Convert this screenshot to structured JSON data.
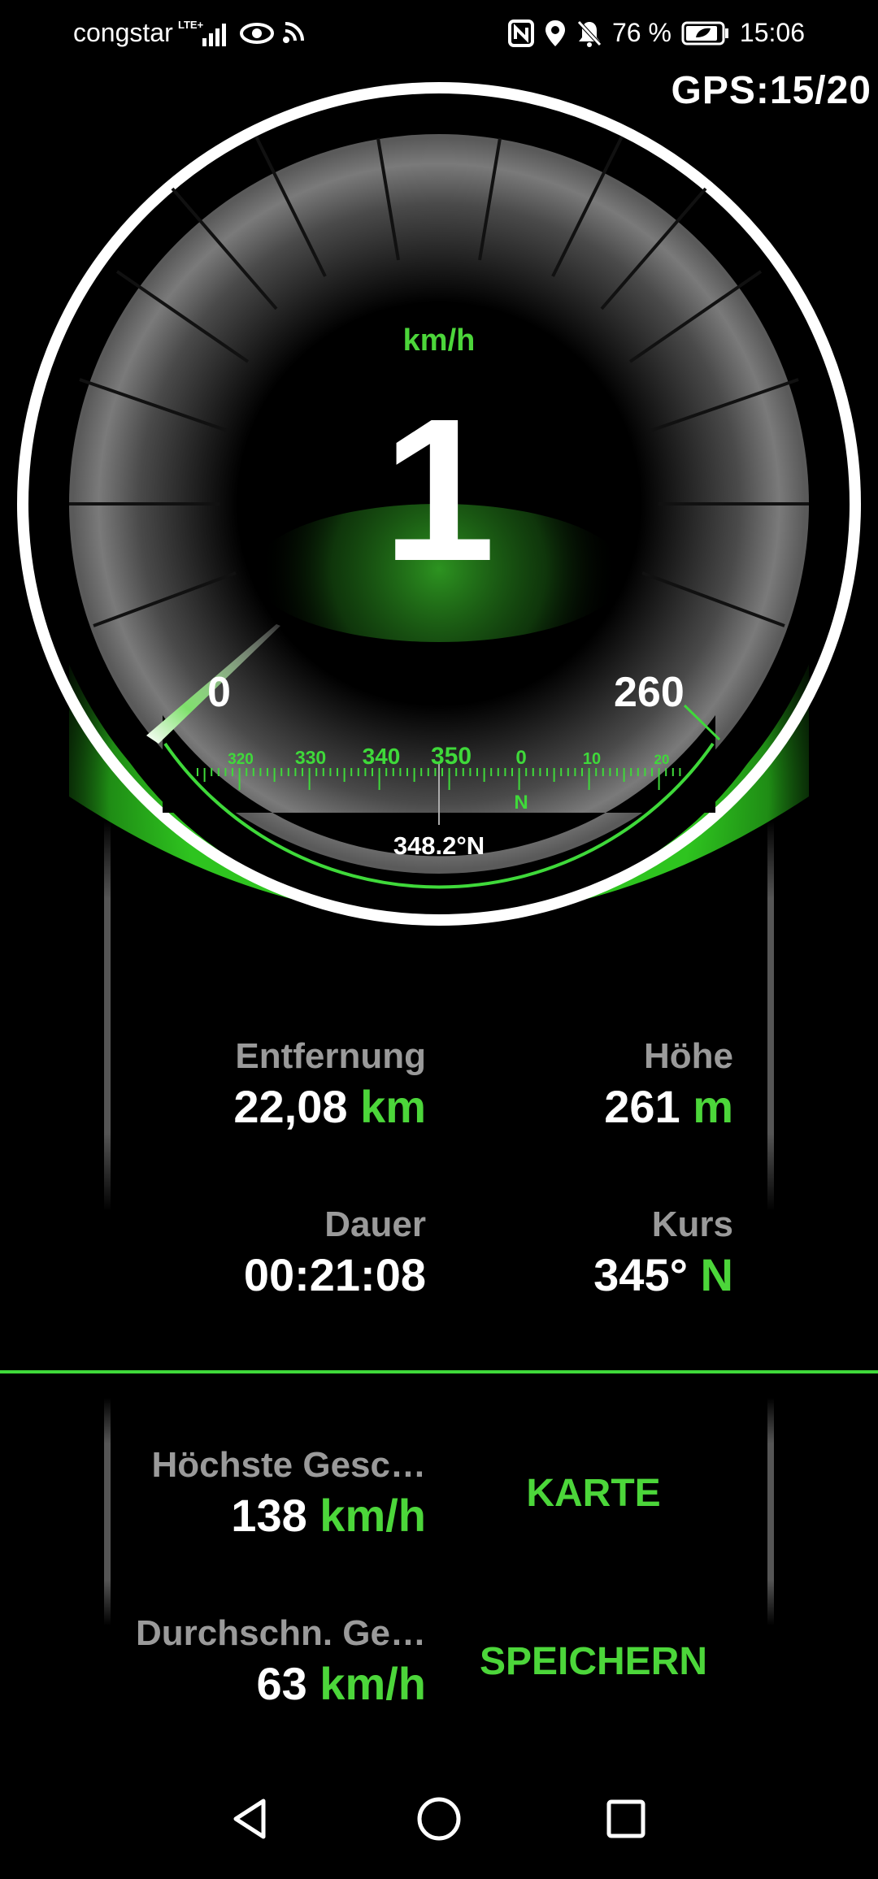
{
  "status_bar": {
    "carrier": "congstar",
    "network": "LTE+",
    "battery": "76 %",
    "time": "15:06",
    "icons": [
      "signal-icon",
      "eye-icon",
      "hotspot-icon",
      "nfc-icon",
      "location-icon",
      "mute-icon",
      "battery-icon"
    ]
  },
  "gps": {
    "label": "GPS:15/20"
  },
  "speedometer": {
    "unit": "km/h",
    "speed": "1",
    "scale_min": "0",
    "scale_max": "260",
    "compass_ticks": [
      "320",
      "330",
      "340",
      "350",
      "0",
      "10",
      "20"
    ],
    "compass_north": "N",
    "heading": "348.2°N"
  },
  "stats": {
    "distance": {
      "label": "Entfernung",
      "value": "22,08",
      "unit": "km"
    },
    "altitude": {
      "label": "Höhe",
      "value": "261",
      "unit": "m"
    },
    "duration": {
      "label": "Dauer",
      "value": "00:21:08"
    },
    "course": {
      "label": "Kurs",
      "value": "345°",
      "unit": "N"
    },
    "max_speed": {
      "label": "Höchste Gesc…",
      "value": "138",
      "unit": "km/h"
    },
    "avg_speed": {
      "label": "Durchschn. Ge…",
      "value": "63",
      "unit": "km/h"
    }
  },
  "actions": {
    "map": "KARTE",
    "save": "SPEICHERN"
  },
  "colors": {
    "accent": "#4cd63a",
    "background": "#000000",
    "label": "#9a9a9a"
  },
  "navbar": {
    "icons": [
      "back-icon",
      "home-icon",
      "recents-icon"
    ]
  }
}
